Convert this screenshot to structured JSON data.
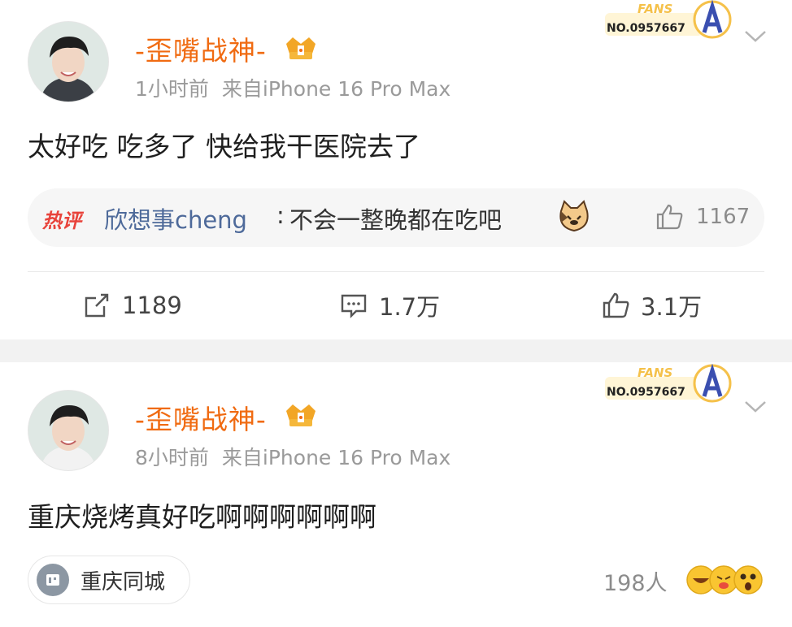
{
  "posts": [
    {
      "username": "-歪嘴战神-",
      "time": "1小时前",
      "source": "来自iPhone 16 Pro Max",
      "fans_badge": {
        "label": "FANS",
        "number": "NO.0957667"
      },
      "text": "太好吃 吃多了 快给我干医院去了",
      "hot_comment": {
        "tag": "热评",
        "user": "欣想事cheng",
        "colon": ":",
        "text": "不会一整晚都在吃吧",
        "likes": "1167"
      },
      "actions": {
        "share": "1189",
        "comment": "1.7万",
        "like": "3.1万"
      }
    },
    {
      "username": "-歪嘴战神-",
      "time": "8小时前",
      "source": "来自iPhone 16 Pro Max",
      "fans_badge": {
        "label": "FANS",
        "number": "NO.0957667"
      },
      "text": "重庆烧烤真好吃啊啊啊啊啊啊",
      "location": "重庆同城",
      "reactions": "198人"
    }
  ],
  "colors": {
    "username": "#f06b12",
    "meta": "#9a9a9a",
    "hot_user": "#4e6a9a",
    "hot_tag": "#e8433b",
    "separator": "#f2f2f2"
  },
  "icons": {
    "share": "share-icon",
    "comment": "comment-icon",
    "like": "thumbs-up-icon",
    "location": "location-pin-icon",
    "chevron": "chevron-down-icon"
  }
}
